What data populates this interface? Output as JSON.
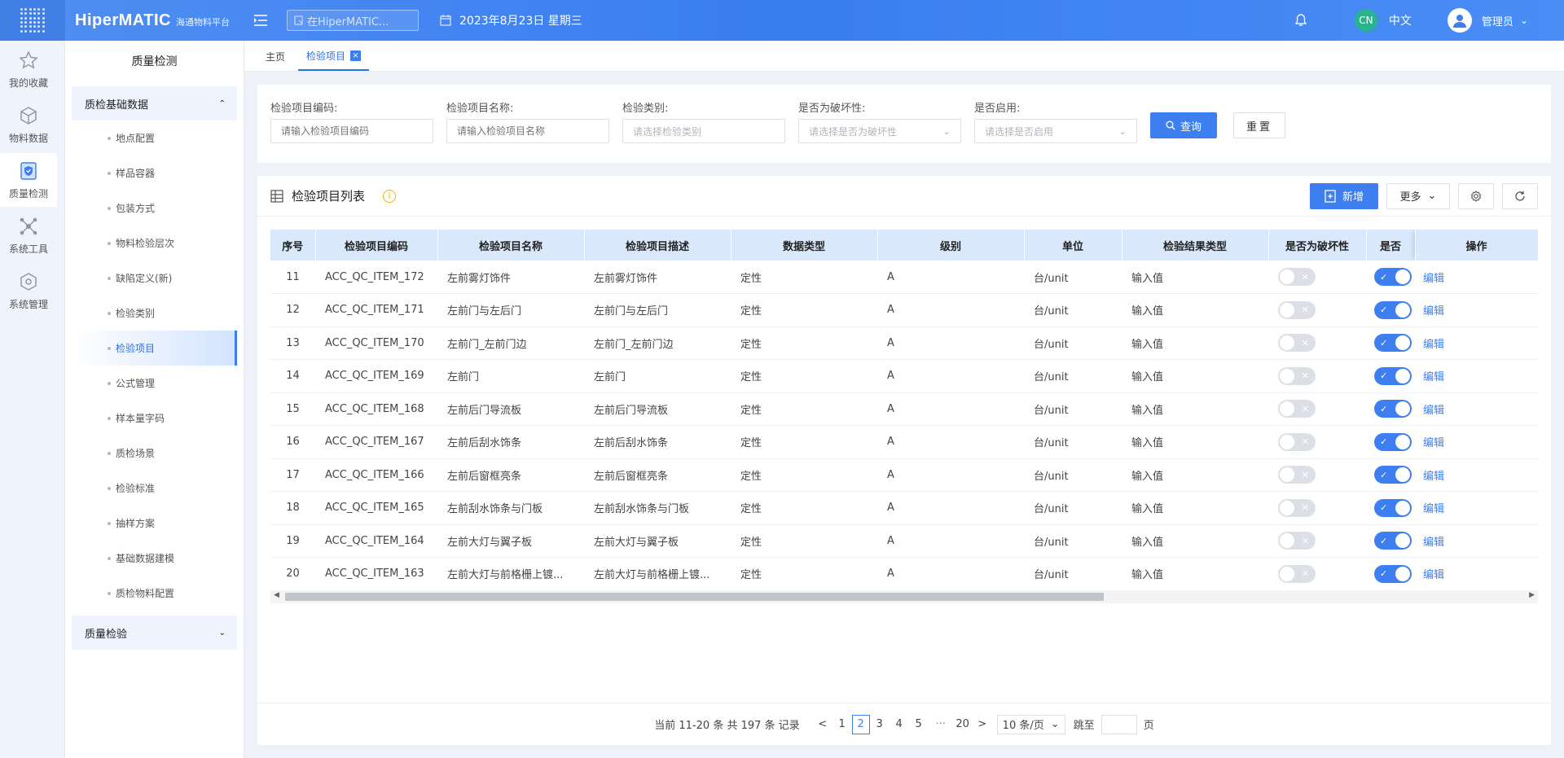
{
  "header": {
    "logo_main": "HiperMATIC",
    "logo_sub": "海通物料平台",
    "search_placeholder": "在HiperMATIC...",
    "date": "2023年8月23日 星期三",
    "lang_badge": "CN",
    "lang_label": "中文",
    "user_name": "管理员"
  },
  "rail": {
    "items": [
      {
        "label": "我的收藏",
        "icon": "star-icon"
      },
      {
        "label": "物料数据",
        "icon": "cube-icon"
      },
      {
        "label": "质量检测",
        "icon": "shield-check-icon"
      },
      {
        "label": "系统工具",
        "icon": "network-icon"
      },
      {
        "label": "系统管理",
        "icon": "settings-cube-icon"
      }
    ]
  },
  "sidebar": {
    "title": "质量检测",
    "group1": "质检基础数据",
    "items": [
      "地点配置",
      "样品容器",
      "包装方式",
      "物料检验层次",
      "缺陷定义(新)",
      "检验类别",
      "检验项目",
      "公式管理",
      "样本量字码",
      "质检场景",
      "检验标准",
      "抽样方案",
      "基础数据建模",
      "质检物料配置"
    ],
    "group2": "质量检验"
  },
  "tabs": {
    "home": "主页",
    "current": "检验项目",
    "close": "×"
  },
  "filters": {
    "code_label": "检验项目编码:",
    "code_placeholder": "请输入检验项目编码",
    "name_label": "检验项目名称:",
    "name_placeholder": "请输入检验项目名称",
    "category_label": "检验类别:",
    "category_placeholder": "请选择检验类别",
    "destructive_label": "是否为破坏性:",
    "destructive_placeholder": "请选择是否为破坏性",
    "enabled_label": "是否启用:",
    "enabled_placeholder": "请选择是否启用",
    "query_label": "查询",
    "reset_label": "重置"
  },
  "list": {
    "title": "检验项目列表",
    "add_label": "新增",
    "more_label": "更多",
    "columns": [
      "序号",
      "检验项目编码",
      "检验项目名称",
      "检验项目描述",
      "数据类型",
      "级别",
      "单位",
      "检验结果类型",
      "是否为破坏性",
      "是否",
      "操作"
    ],
    "rows": [
      {
        "no": "11",
        "code": "ACC_QC_ITEM_172",
        "name": "左前雾灯饰件",
        "desc": "左前雾灯饰件",
        "type": "定性",
        "level": "A",
        "unit": "台/unit",
        "result": "输入值",
        "edit": "编辑"
      },
      {
        "no": "12",
        "code": "ACC_QC_ITEM_171",
        "name": "左前门与左后门",
        "desc": "左前门与左后门",
        "type": "定性",
        "level": "A",
        "unit": "台/unit",
        "result": "输入值",
        "edit": "编辑"
      },
      {
        "no": "13",
        "code": "ACC_QC_ITEM_170",
        "name": "左前门_左前门边",
        "desc": "左前门_左前门边",
        "type": "定性",
        "level": "A",
        "unit": "台/unit",
        "result": "输入值",
        "edit": "编辑"
      },
      {
        "no": "14",
        "code": "ACC_QC_ITEM_169",
        "name": "左前门",
        "desc": "左前门",
        "type": "定性",
        "level": "A",
        "unit": "台/unit",
        "result": "输入值",
        "edit": "编辑"
      },
      {
        "no": "15",
        "code": "ACC_QC_ITEM_168",
        "name": "左前后门导流板",
        "desc": "左前后门导流板",
        "type": "定性",
        "level": "A",
        "unit": "台/unit",
        "result": "输入值",
        "edit": "编辑"
      },
      {
        "no": "16",
        "code": "ACC_QC_ITEM_167",
        "name": "左前后刮水饰条",
        "desc": "左前后刮水饰条",
        "type": "定性",
        "level": "A",
        "unit": "台/unit",
        "result": "输入值",
        "edit": "编辑"
      },
      {
        "no": "17",
        "code": "ACC_QC_ITEM_166",
        "name": "左前后窗框亮条",
        "desc": "左前后窗框亮条",
        "type": "定性",
        "level": "A",
        "unit": "台/unit",
        "result": "输入值",
        "edit": "编辑"
      },
      {
        "no": "18",
        "code": "ACC_QC_ITEM_165",
        "name": "左前刮水饰条与门板",
        "desc": "左前刮水饰条与门板",
        "type": "定性",
        "level": "A",
        "unit": "台/unit",
        "result": "输入值",
        "edit": "编辑"
      },
      {
        "no": "19",
        "code": "ACC_QC_ITEM_164",
        "name": "左前大灯与翼子板",
        "desc": "左前大灯与翼子板",
        "type": "定性",
        "level": "A",
        "unit": "台/unit",
        "result": "输入值",
        "edit": "编辑"
      },
      {
        "no": "20",
        "code": "ACC_QC_ITEM_163",
        "name": "左前大灯与前格栅上镀...",
        "desc": "左前大灯与前格栅上镀...",
        "type": "定性",
        "level": "A",
        "unit": "台/unit",
        "result": "输入值",
        "edit": "编辑"
      }
    ]
  },
  "pager": {
    "total": "当前 11-20 条 共 197 条 记录",
    "prev": "<",
    "pages": [
      "1",
      "2",
      "3",
      "4",
      "5"
    ],
    "ellipsis": "···",
    "last": "20",
    "next": ">",
    "size": "10 条/页",
    "jump_label": "跳至",
    "page_suffix": "页"
  },
  "colors": {
    "primary": "#3d7ef1",
    "header": "#4f8ff3",
    "table_header": "#d9e8fb"
  }
}
